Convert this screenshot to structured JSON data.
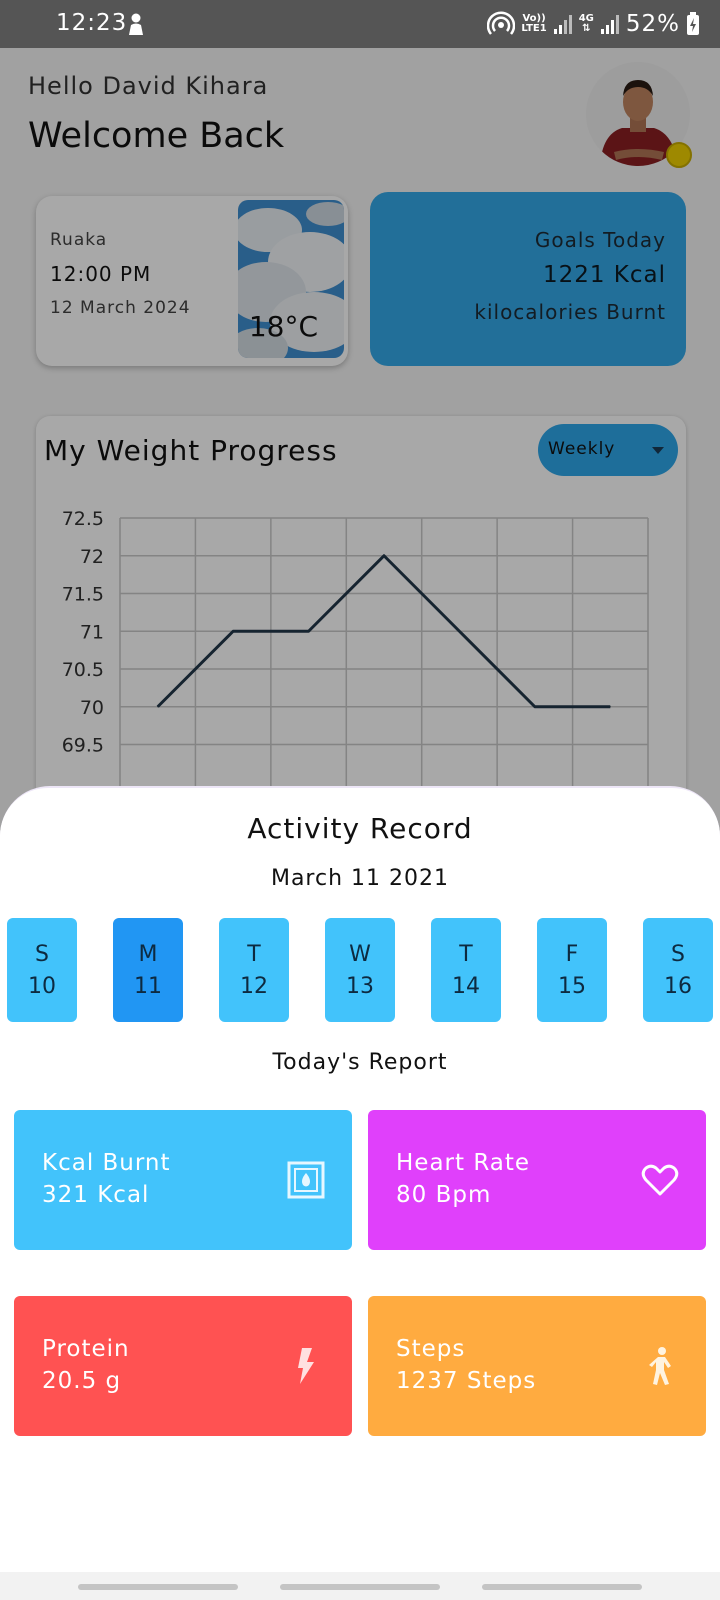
{
  "status_bar": {
    "time": "12:23",
    "network_top": "Vo))",
    "network_bottom": "LTE1",
    "network_type": "4G",
    "battery": "52%",
    "icons": [
      "person-icon",
      "hotspot-icon",
      "signal-icon",
      "signal-icon",
      "battery-icon"
    ]
  },
  "header": {
    "greeting": "Hello David Kihara",
    "welcome": "Welcome Back"
  },
  "weather": {
    "location": "Ruaka",
    "time": "12:00 PM",
    "date": "12 March 2024",
    "temperature": "18°C"
  },
  "goals": {
    "title": "Goals Today",
    "value": "1221 Kcal",
    "unit": "kilocalories Burnt"
  },
  "weight_progress": {
    "title": "My Weight Progress",
    "period": "Weekly"
  },
  "chart_data": {
    "type": "line",
    "x": [
      1,
      2,
      3,
      4,
      5,
      6,
      7
    ],
    "series": [
      {
        "values": [
          70,
          71,
          71,
          72,
          71,
          70,
          70
        ]
      }
    ],
    "y_ticks": [
      "72.5",
      "72",
      "71.5",
      "71",
      "70.5",
      "70",
      "69.5"
    ],
    "ylim": [
      69.5,
      72.5
    ],
    "grid": true,
    "line_color": "#22374a"
  },
  "activity": {
    "title": "Activity Record",
    "date": "March 11 2021",
    "days": [
      {
        "letter": "S",
        "num": "10"
      },
      {
        "letter": "M",
        "num": "11"
      },
      {
        "letter": "T",
        "num": "12"
      },
      {
        "letter": "W",
        "num": "13"
      },
      {
        "letter": "T",
        "num": "14"
      },
      {
        "letter": "F",
        "num": "15"
      },
      {
        "letter": "S",
        "num": "16"
      }
    ],
    "selected_day": "11"
  },
  "report": {
    "title": "Today's Report",
    "kcal": {
      "label": "Kcal Burnt",
      "value": "321 Kcal",
      "color": "#42c3fb",
      "icon": "fireplace-icon"
    },
    "heart": {
      "label": "Heart Rate",
      "value": "80 Bpm",
      "color": "#e040fb",
      "icon": "heart-icon"
    },
    "protein": {
      "label": "Protein",
      "value": "20.5 g",
      "color": "#ff5252",
      "icon": "lightning-icon"
    },
    "steps": {
      "label": "Steps",
      "value": "1237 Steps",
      "color": "#ffab40",
      "icon": "walking-icon"
    }
  }
}
